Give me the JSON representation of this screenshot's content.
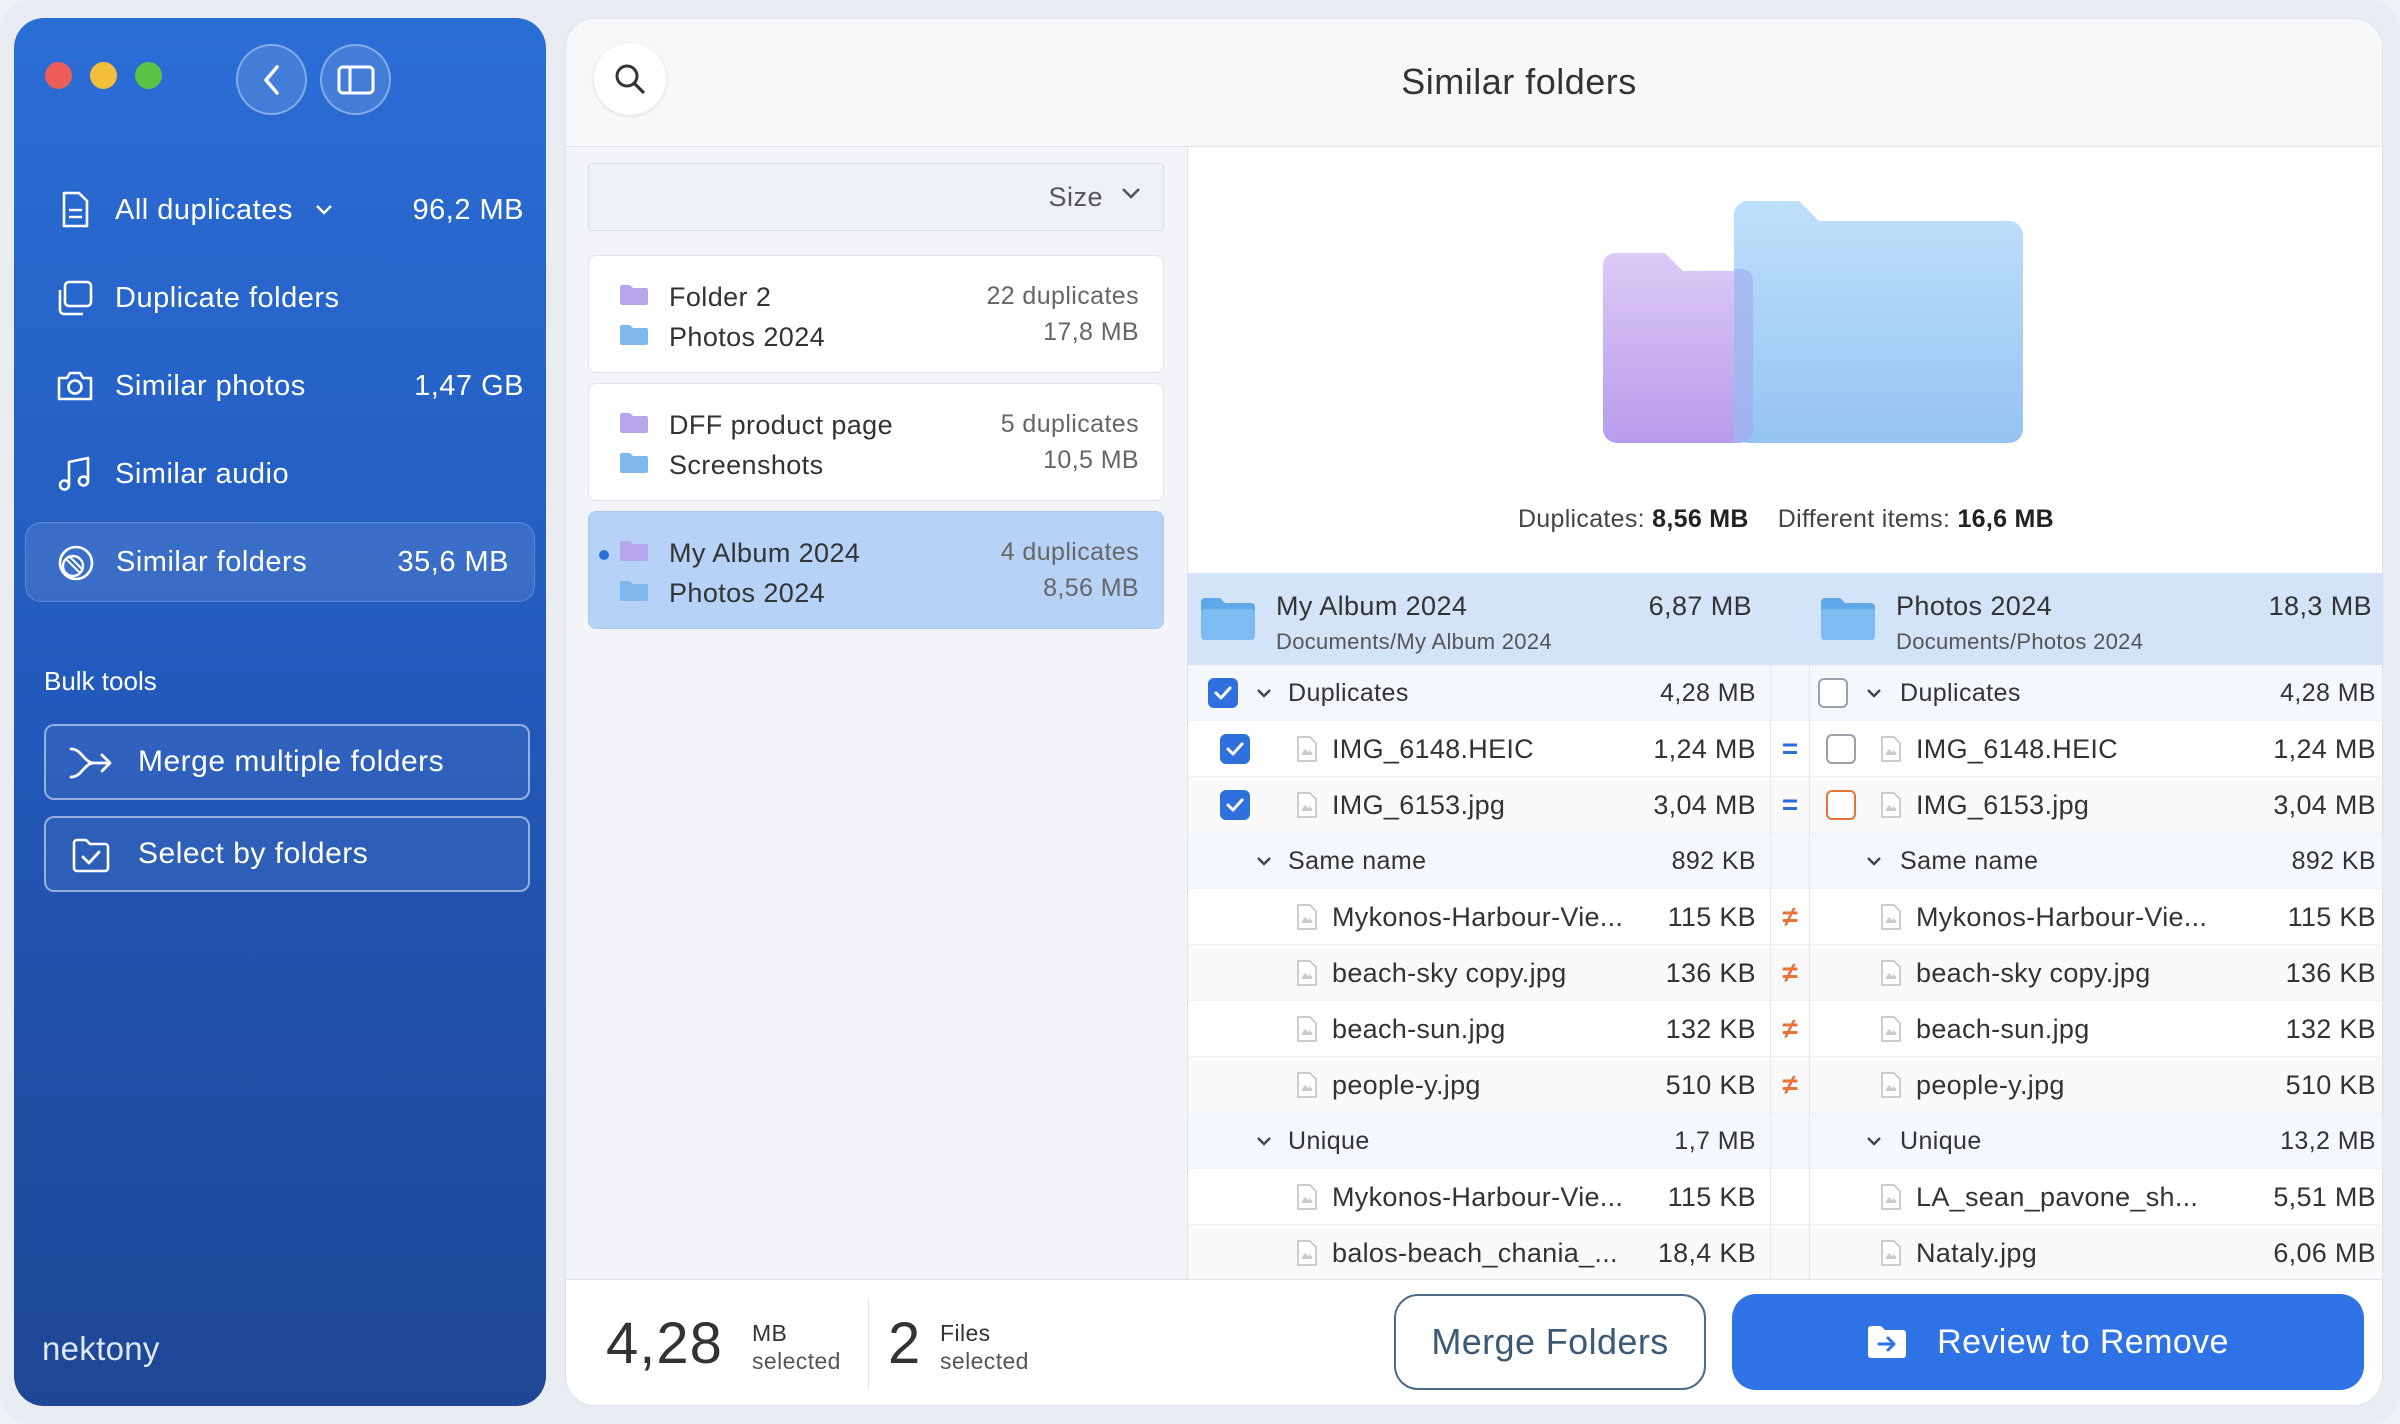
{
  "sidebar": {
    "items": [
      {
        "label": "All duplicates",
        "size": "96,2 MB",
        "icon": "document-icon"
      },
      {
        "label": "Duplicate folders",
        "size": "",
        "icon": "folders-icon"
      },
      {
        "label": "Similar photos",
        "size": "1,47 GB",
        "icon": "camera-icon"
      },
      {
        "label": "Similar audio",
        "size": "",
        "icon": "music-note-icon"
      },
      {
        "label": "Similar folders",
        "size": "35,6 MB",
        "icon": "similar-folders-icon"
      }
    ],
    "bulk_title": "Bulk tools",
    "bulk": [
      {
        "label": "Merge multiple folders",
        "icon": "merge-icon"
      },
      {
        "label": "Select by folders",
        "icon": "folder-check-icon"
      }
    ],
    "logo": "nektony"
  },
  "header": {
    "title": "Similar folders"
  },
  "list": {
    "sort_label": "Size",
    "pairs": [
      {
        "name1": "Folder 2",
        "name2": "Photos 2024",
        "dups": "22 duplicates",
        "size": "17,8 MB"
      },
      {
        "name1": "DFF product page",
        "name2": "Screenshots",
        "dups": "5 duplicates",
        "size": "10,5 MB"
      },
      {
        "name1": "My Album 2024",
        "name2": "Photos 2024",
        "dups": "4 duplicates",
        "size": "8,56 MB"
      }
    ]
  },
  "detail": {
    "dup_label": "Duplicates:",
    "dup_value": "8,56 MB",
    "diff_label": "Different items:",
    "diff_value": "16,6 MB",
    "left": {
      "name": "My Album 2024",
      "path": "Documents/My Album 2024",
      "size": "6,87 MB"
    },
    "right": {
      "name": "Photos 2024",
      "path": "Documents/Photos 2024",
      "size": "18,3 MB"
    },
    "rows": {
      "g_dup": {
        "l_name": "Duplicates",
        "l_size": "4,28 MB",
        "r_name": "Duplicates",
        "r_size": "4,28 MB"
      },
      "r1": {
        "l_name": "IMG_6148.HEIC",
        "l_size": "1,24 MB",
        "r_name": "IMG_6148.HEIC",
        "r_size": "1,24 MB",
        "mid": "="
      },
      "r2": {
        "l_name": "IMG_6153.jpg",
        "l_size": "3,04 MB",
        "r_name": "IMG_6153.jpg",
        "r_size": "3,04 MB",
        "mid": "="
      },
      "g_same": {
        "l_name": "Same name",
        "l_size": "892 KB",
        "r_name": "Same name",
        "r_size": "892 KB"
      },
      "r3": {
        "l_name": "Mykonos-Harbour-Vie...",
        "l_size": "115 KB",
        "r_name": "Mykonos-Harbour-Vie...",
        "r_size": "115 KB",
        "mid": "≠"
      },
      "r4": {
        "l_name": "beach-sky copy.jpg",
        "l_size": "136 KB",
        "r_name": "beach-sky copy.jpg",
        "r_size": "136 KB",
        "mid": "≠"
      },
      "r5": {
        "l_name": "beach-sun.jpg",
        "l_size": "132 KB",
        "r_name": "beach-sun.jpg",
        "r_size": "132 KB",
        "mid": "≠"
      },
      "r6": {
        "l_name": "people-y.jpg",
        "l_size": "510 KB",
        "r_name": "people-y.jpg",
        "r_size": "510 KB",
        "mid": "≠"
      },
      "g_uniq": {
        "l_name": "Unique",
        "l_size": "1,7 MB",
        "r_name": "Unique",
        "r_size": "13,2 MB"
      },
      "r7": {
        "l_name": "Mykonos-Harbour-Vie...",
        "l_size": "115 KB",
        "r_name": "LA_sean_pavone_sh...",
        "r_size": "5,51 MB"
      },
      "r8": {
        "l_name": "balos-beach_chania_...",
        "l_size": "18,4 KB",
        "r_name": "Nataly.jpg",
        "r_size": "6,06 MB"
      }
    }
  },
  "footer": {
    "mb_value": "4,28",
    "mb_unit": "MB",
    "mb_label": "selected",
    "files_value": "2",
    "files_unit": "Files",
    "files_label": "selected",
    "merge_label": "Merge Folders",
    "review_label": "Review to Remove"
  },
  "colors": {
    "accent": "#2f72e5",
    "sidebar": "#2259bb",
    "warn": "#e8733a"
  }
}
